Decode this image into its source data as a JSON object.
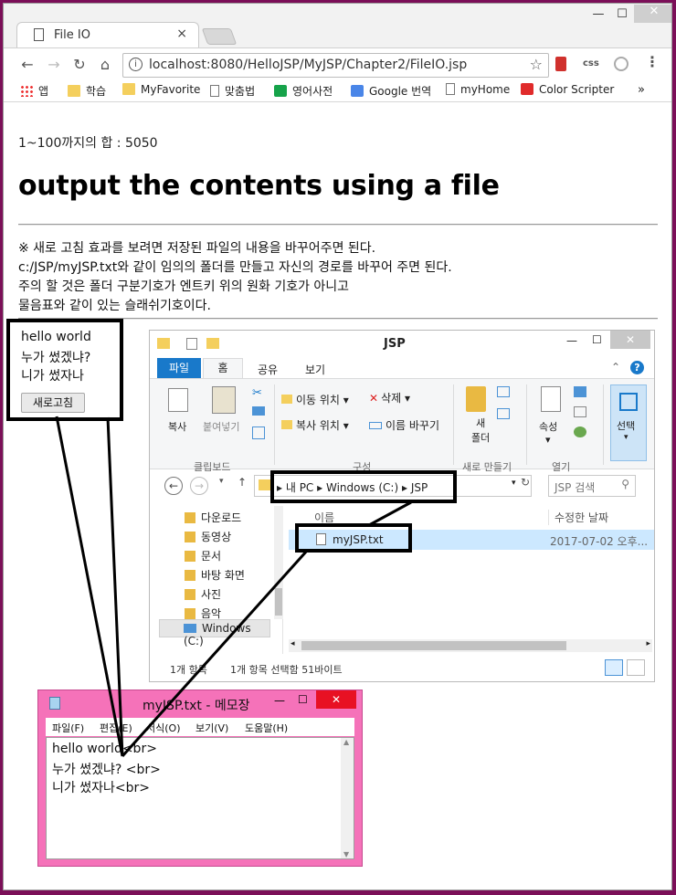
{
  "browser": {
    "tab_title": "File IO",
    "tab_close": "×",
    "url": "localhost:8080/HelloJSP/MyJSP/Chapter2/FileIO.jsp",
    "window_controls": {
      "minimize": "—",
      "maximize": "☐",
      "close": "✕"
    },
    "nav": {
      "back": "←",
      "forward": "→",
      "reload": "↻",
      "home": "⌂"
    },
    "extensions": [
      "css"
    ],
    "bookmarks": [
      {
        "label": "앱",
        "icon": "apps-grid-icon"
      },
      {
        "label": "학습",
        "icon": "folder-icon"
      },
      {
        "label": "MyFavorite",
        "icon": "folder-icon"
      },
      {
        "label": "맞춤법",
        "icon": "page-icon"
      },
      {
        "label": "영어사전",
        "icon": "dict-icon"
      },
      {
        "label": "Google 번역",
        "icon": "google-translate-icon"
      },
      {
        "label": "myHome",
        "icon": "page-icon"
      },
      {
        "label": "Color Scripter",
        "icon": "color-scripter-icon"
      }
    ],
    "bookmarks_more": "»"
  },
  "page": {
    "sum_text": "1~100까지의 합 : 5050",
    "heading": "output the contents using a file",
    "notes": [
      "※ 새로 고침 효과를 보려면 저장된 파일의 내용을 바꾸어주면 된다.",
      "c:/JSP/myJSP.txt와 같이 임의의 폴더를 만들고 자신의 경로를 바꾸어 주면 된다.",
      "주의 할 것은 폴더 구분기호가 엔트키 위의 원화 기호가 아니고",
      "물음표와 같이 있는 슬래쉬기호이다."
    ],
    "file_lines": [
      "hello world",
      "누가 썼겠냐?",
      "니가 썼자나"
    ],
    "refresh_button": "새로고침"
  },
  "explorer": {
    "title": "JSP",
    "tabs": [
      "파일",
      "홈",
      "공유",
      "보기"
    ],
    "ribbon": {
      "clipboard": {
        "copy": "복사",
        "paste": "붙여넣기",
        "group": "클립보드"
      },
      "organize": {
        "move_to": "이동 위치",
        "copy_to": "복사 위치",
        "delete": "삭제",
        "rename": "이름 바꾸기",
        "group": "구성"
      },
      "new": {
        "new_folder_line1": "새",
        "new_folder_line2": "폴더",
        "group": "새로 만들기"
      },
      "open": {
        "properties": "속성",
        "group": "열기"
      },
      "select": {
        "label": "선택"
      }
    },
    "breadcrumb": [
      "내 PC",
      "Windows (C:)",
      "JSP"
    ],
    "search_placeholder": "JSP 검색",
    "sidebar": [
      "다운로드",
      "동영상",
      "문서",
      "바탕 화면",
      "사진",
      "음악",
      "Windows (C:)"
    ],
    "columns": {
      "name": "이름",
      "modified": "수정한 날짜"
    },
    "files": [
      {
        "name": "myJSP.txt",
        "modified": "2017-07-02 오후..."
      }
    ],
    "status": {
      "count": "1개 항목",
      "selected": "1개 항목 선택함 51바이트"
    }
  },
  "notepad": {
    "title": "myJSP.txt - 메모장",
    "menu": [
      "파일(F)",
      "편집(E)",
      "서식(O)",
      "보기(V)",
      "도움말(H)"
    ],
    "lines": [
      "hello world<br>",
      "누가 썼겠냐? <br>",
      "니가 썼자나<br>"
    ]
  },
  "colors": {
    "frame": "#7b0f58",
    "notepad_frame": "#f572b9",
    "tab_blue": "#1979ca",
    "close_red": "#e81123"
  }
}
